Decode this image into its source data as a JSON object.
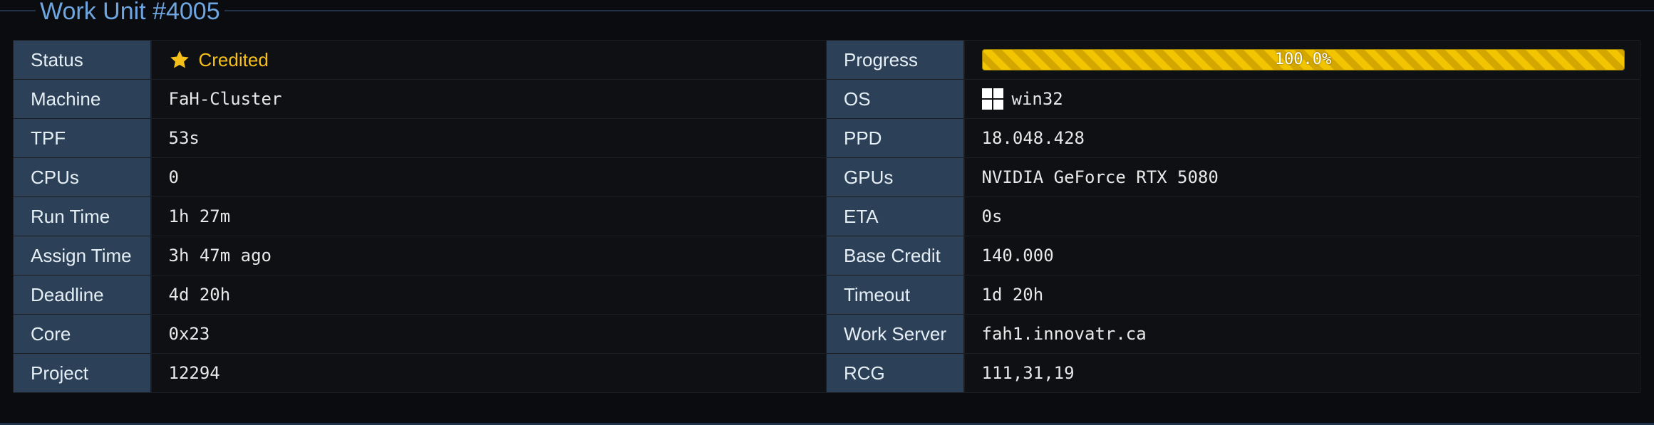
{
  "title": "Work Unit #4005",
  "left": [
    {
      "label": "Status",
      "value": "Credited"
    },
    {
      "label": "Machine",
      "value": "FaH-Cluster"
    },
    {
      "label": "TPF",
      "value": "53s"
    },
    {
      "label": "CPUs",
      "value": "0"
    },
    {
      "label": "Run Time",
      "value": "1h 27m"
    },
    {
      "label": "Assign Time",
      "value": "3h 47m ago"
    },
    {
      "label": "Deadline",
      "value": "4d 20h"
    },
    {
      "label": "Core",
      "value": "0x23"
    },
    {
      "label": "Project",
      "value": "12294"
    }
  ],
  "right": [
    {
      "label": "Progress",
      "value": "100.0%"
    },
    {
      "label": "OS",
      "value": "win32"
    },
    {
      "label": "PPD",
      "value": "18.048.428"
    },
    {
      "label": "GPUs",
      "value": "NVIDIA GeForce RTX 5080"
    },
    {
      "label": "ETA",
      "value": "0s"
    },
    {
      "label": "Base Credit",
      "value": "140.000"
    },
    {
      "label": "Timeout",
      "value": "1d 20h"
    },
    {
      "label": "Work Server",
      "value": "fah1.innovatr.ca"
    },
    {
      "label": "RCG",
      "value": "111,31,19"
    }
  ],
  "progress_fraction": 1.0,
  "icons": {
    "status": "star-icon",
    "os": "windows-icon"
  },
  "colors": {
    "title": "#6fa6e0",
    "label_bg": "#2c4157",
    "status_credited": "#f5c01a",
    "progress_bar": "#f2c500"
  }
}
